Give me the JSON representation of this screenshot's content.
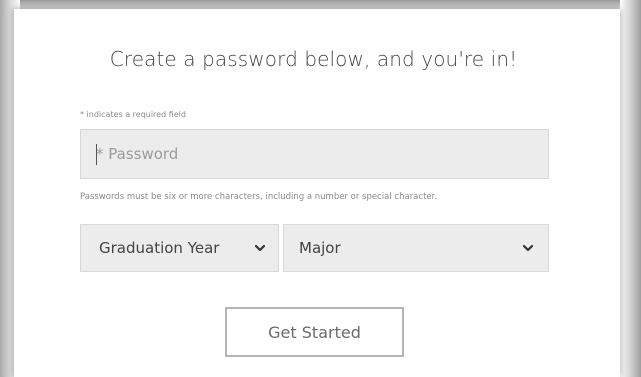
{
  "form": {
    "heading": "Create a password below, and you're in!",
    "required_note": "* indicates a required field",
    "password": {
      "value": "",
      "placeholder": "* Password"
    },
    "password_hint": "Passwords must be six or more characters, including a number or special character.",
    "graduation_year": {
      "selected": "Graduation Year",
      "icon": "chevron-down-icon"
    },
    "major": {
      "selected": "Major",
      "icon": "chevron-down-icon"
    },
    "submit_label": "Get Started"
  },
  "colors": {
    "field_background": "#ececec",
    "text": "#444444",
    "muted_text": "#8a8a8a",
    "button_border": "#b5b5b5"
  }
}
